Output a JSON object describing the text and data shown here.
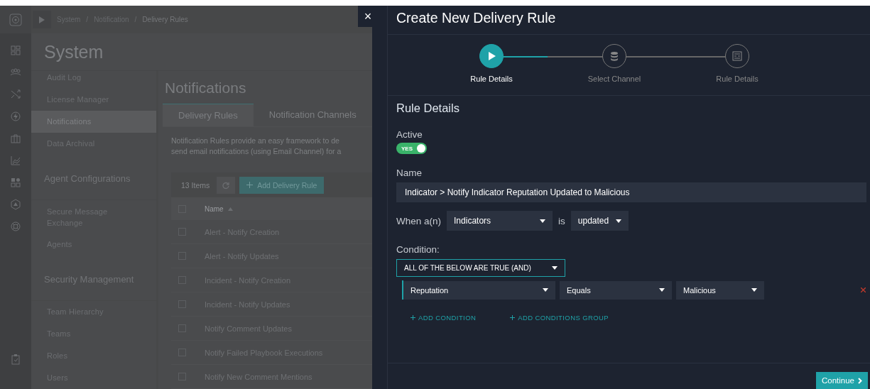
{
  "breadcrumb": {
    "items": [
      "System",
      "Notification",
      "Delivery Rules"
    ],
    "separator": "/"
  },
  "page_title": "System",
  "settings_menu": [
    {
      "kind": "item",
      "label": "Audit Log",
      "selected": false
    },
    {
      "kind": "item",
      "label": "License Manager",
      "selected": false
    },
    {
      "kind": "item",
      "label": "Notifications",
      "selected": true
    },
    {
      "kind": "item",
      "label": "Data Archival",
      "selected": false
    },
    {
      "kind": "heading",
      "label": "Agent Configurations"
    },
    {
      "kind": "item",
      "label": "Secure Message Exchange",
      "selected": false
    },
    {
      "kind": "item",
      "label": "Agents",
      "selected": false
    },
    {
      "kind": "heading",
      "label": "Security Management"
    },
    {
      "kind": "item",
      "label": "Team Hierarchy",
      "selected": false
    },
    {
      "kind": "item",
      "label": "Teams",
      "selected": false
    },
    {
      "kind": "item",
      "label": "Roles",
      "selected": false
    },
    {
      "kind": "item",
      "label": "Users",
      "selected": false
    }
  ],
  "notifications": {
    "title": "Notifications",
    "tabs": [
      {
        "label": "Delivery Rules",
        "selected": true
      },
      {
        "label": "Notification Channels",
        "selected": false
      }
    ],
    "description_lines": [
      "Notification Rules provide an easy framework to de",
      "send email notifications (using Email Channel) for a"
    ],
    "item_count": "13 Items",
    "add_button": "Add Delivery Rule",
    "table": {
      "columns": [
        "Name"
      ],
      "select_all_checked": false,
      "rows": [
        {
          "name": "Alert - Notify Creation",
          "checked": false
        },
        {
          "name": "Alert - Notify Updates",
          "checked": false
        },
        {
          "name": "Incident - Notify Creation",
          "checked": false
        },
        {
          "name": "Incident - Notify Updates",
          "checked": false
        },
        {
          "name": "Notify Comment Updates",
          "checked": false
        },
        {
          "name": "Notify Failed Playbook Executions",
          "checked": false
        },
        {
          "name": "Notify New Comment Mentions",
          "checked": false
        }
      ]
    }
  },
  "close_label": "×",
  "modal": {
    "title": "Create New Delivery Rule",
    "steps": [
      {
        "label": "Rule Details",
        "selected": true
      },
      {
        "label": "Select Channel",
        "selected": false
      },
      {
        "label": "Rule Details",
        "selected": false
      }
    ],
    "section_title": "Rule Details",
    "active": {
      "label": "Active",
      "on": true,
      "on_text": "YES"
    },
    "name": {
      "label": "Name",
      "value": "Indicator > Notify Indicator Reputation Updated to Malicious"
    },
    "trigger": {
      "prefix": "When a(n)",
      "module": "Indicators",
      "middle": "is",
      "event": "updated"
    },
    "condition": {
      "label": "Condition:",
      "group_logic": "ALL OF THE BELOW ARE TRUE (AND)",
      "rules": [
        {
          "field": "Reputation",
          "operator": "Equals",
          "value": "Malicious"
        }
      ],
      "links": [
        "ADD CONDITION",
        "ADD CONDITIONS GROUP"
      ]
    },
    "continue_button": "Continue"
  }
}
